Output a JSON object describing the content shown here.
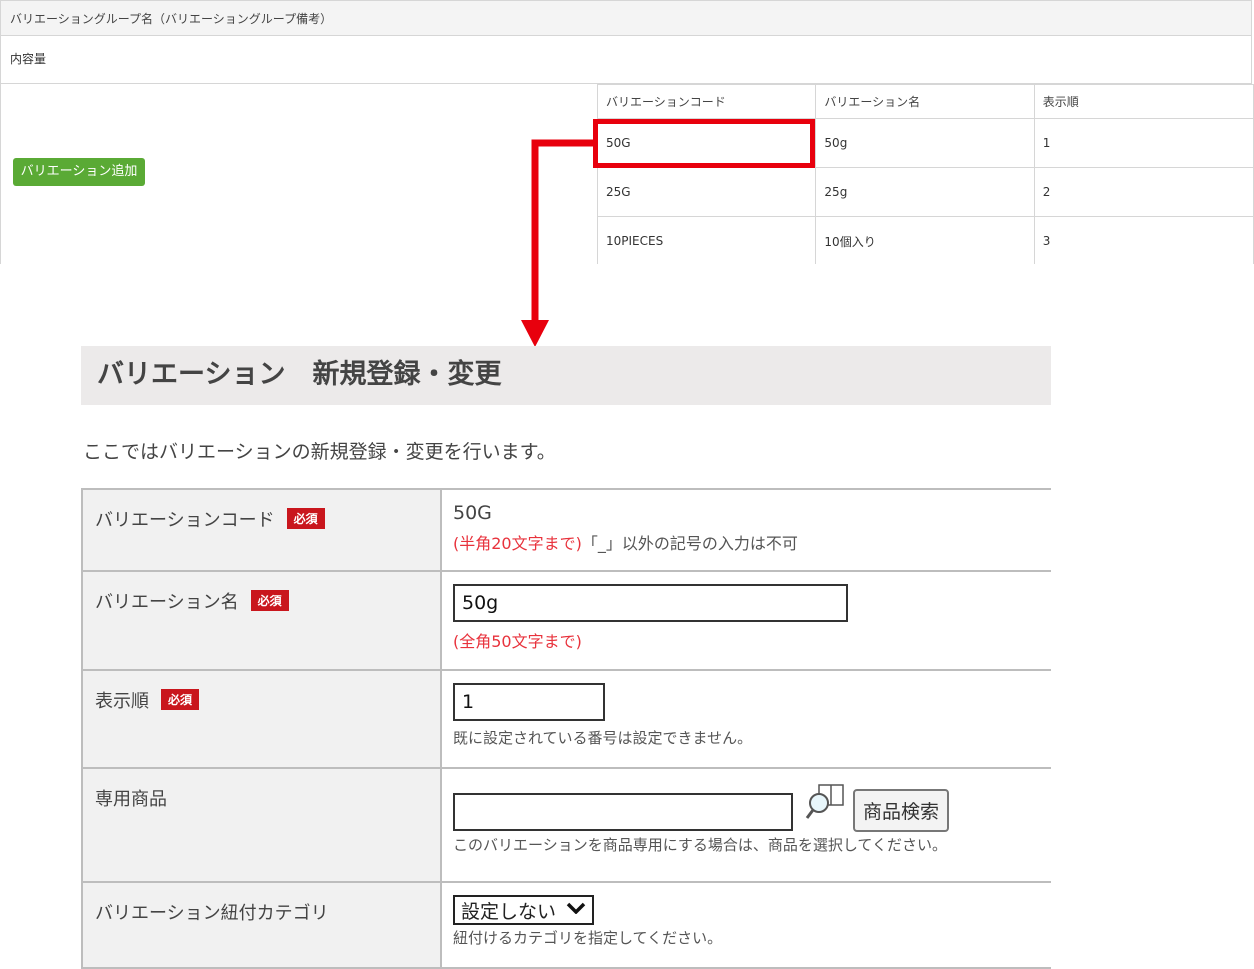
{
  "list": {
    "group_header": "バリエーショングループ名（バリエーショングループ備考）",
    "group_name": "内容量",
    "add_button": "バリエーション追加",
    "columns": [
      "バリエーションコード",
      "バリエーション名",
      "表示順"
    ],
    "rows": [
      [
        "50G",
        "50g",
        "1"
      ],
      [
        "25G",
        "25g",
        "2"
      ],
      [
        "10PIECES",
        "10個入り",
        "3"
      ]
    ]
  },
  "form": {
    "title": "バリエーション　新規登録・変更",
    "intro": "ここではバリエーションの新規登録・変更を行います。",
    "required_badge": "必須",
    "code_label": "バリエーションコード",
    "code_value": "50G",
    "code_note_red": "(半角20文字まで)",
    "code_note_gray": "「_」以外の記号の入力は不可",
    "name_label": "バリエーション名",
    "name_value": "50g",
    "name_note": "(全角50文字まで)",
    "order_label": "表示順",
    "order_value": "1",
    "order_note": "既に設定されている番号は設定できません。",
    "product_label": "専用商品",
    "product_value": "",
    "product_search_button": "商品検索",
    "product_note": "このバリエーションを商品専用にする場合は、商品を選択してください。",
    "category_label": "バリエーション紐付カテゴリ",
    "category_selected": "設定しない",
    "category_note": "紐付けるカテゴリを指定してください。"
  },
  "colors": {
    "highlight": "#e8000d",
    "add_button": "#5aaa35",
    "required_badge": "#c9161d"
  },
  "icons": {
    "product_search": "book-magnifier-icon",
    "select": "chevron-down-icon"
  }
}
